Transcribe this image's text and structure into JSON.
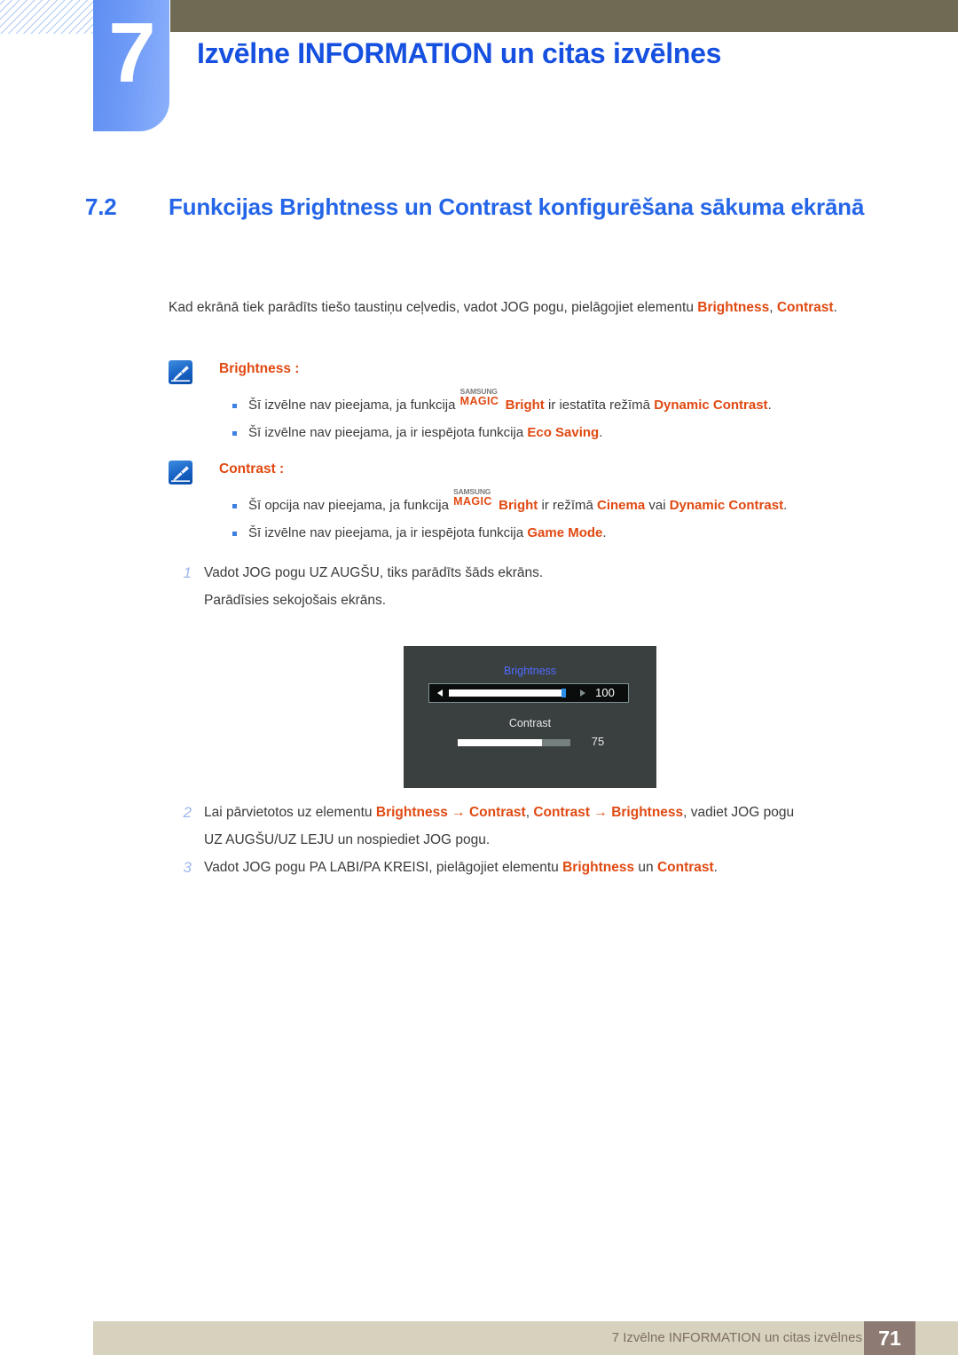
{
  "chapter": {
    "number": "7",
    "title": "Izvēlne INFORMATION un citas izvēlnes"
  },
  "section": {
    "number": "7.2",
    "title": "Funkcijas Brightness un Contrast konfigurēšana sākuma ekrānā"
  },
  "intro": {
    "part1": "Kad ekrānā tiek parādīts tiešo taustiņu ceļvedis, vadot JOG pogu, pielāgojiet elementu ",
    "hl1": "Brightness",
    "part2": ", ",
    "hl2": "Contrast",
    "part3": "."
  },
  "notes": [
    {
      "icon": "note-pencil-icon",
      "title": "Brightness :",
      "bullets": [
        {
          "pre": "Šī izvēlne nav pieejama, ja funkcija ",
          "magic_top": "SAMSUNG",
          "magic_bottom": "MAGIC",
          "magic_suffix": "Bright",
          "mid": " ir iestatīta režīmā ",
          "hl": "Dynamic Contrast",
          "post": "."
        },
        {
          "pre": "Šī izvēlne nav pieejama, ja ir iespējota funkcija ",
          "hl": "Eco Saving",
          "post": "."
        }
      ]
    },
    {
      "icon": "note-pencil-icon",
      "title": "Contrast :",
      "bullets": [
        {
          "pre": "Šī opcija nav pieejama, ja funkcija ",
          "magic_top": "SAMSUNG",
          "magic_bottom": "MAGIC",
          "magic_suffix": "Bright",
          "mid": " ir režīmā ",
          "hl": "Cinema",
          "mid2": " vai ",
          "hl2": "Dynamic Contrast",
          "post": "."
        },
        {
          "pre": "Šī izvēlne nav pieejama, ja ir iespējota funkcija ",
          "hl": "Game Mode",
          "post": "."
        }
      ]
    }
  ],
  "steps": {
    "step1": {
      "number": "1",
      "line1": "Vadot JOG pogu UZ AUGŠU, tiks parādīts šāds ekrāns.",
      "line2": "Parādīsies sekojošais ekrāns."
    },
    "step2": {
      "number": "2",
      "pre": "Lai pārvietotos uz elementu ",
      "hl1": "Brightness",
      "arrow1": " → ",
      "hl2": "Contrast",
      "sep": ", ",
      "hl3": "Contrast",
      "arrow2": " → ",
      "hl4": "Brightness",
      "post": ", vadiet JOG pogu",
      "line2": "UZ AUGŠU/UZ LEJU un nospiediet JOG pogu."
    },
    "step3": {
      "number": "3",
      "pre": "Vadot JOG pogu PA LABI/PA KREISI, pielāgojiet elementu ",
      "hl1": "Brightness",
      "mid": " un ",
      "hl2": "Contrast",
      "post": "."
    }
  },
  "osd": {
    "brightness_label": "Brightness",
    "brightness_value": "100",
    "contrast_label": "Contrast",
    "contrast_value": "75",
    "left_arrow_icon": "arrow-left-icon",
    "right_arrow_icon": "arrow-right-icon"
  },
  "footer": {
    "text": "7 Izvēlne INFORMATION un citas izvēlnes",
    "page": "71"
  },
  "colors": {
    "chapter_blue": "#1650e0",
    "section_blue": "#2566e8",
    "highlight_orange": "#e04911",
    "tab_blue": "#6f9bf7",
    "olive": "#6e6a54",
    "footer_beige": "#d7d2bd",
    "footer_page_box": "#8d7b73",
    "osd_bg": "#3a3f3f",
    "osd_handle_blue": "#2b8fe8"
  }
}
